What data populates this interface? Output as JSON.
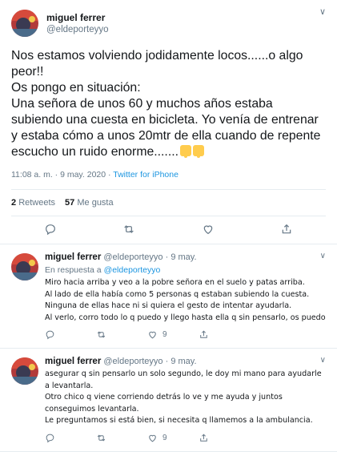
{
  "main_tweet": {
    "name": "miguel ferrer",
    "handle": "@eldeporteyyo",
    "text": "Nos estamos volviendo jodidamente locos......o algo peor!!\nOs pongo en situación:\nUna señora de unos 60 y muchos años estaba subiendo una cuesta en bicicleta. Yo venía de entrenar y estaba cómo a unos 20mtr de ella cuando de repente escucho un ruido enorme.......",
    "timestamp": "11:08 a. m. · 9 may. 2020 · ",
    "source": "Twitter for iPhone",
    "retweets_count": "2",
    "retweets_label": "Retweets",
    "likes_count": "57",
    "likes_label": "Me gusta"
  },
  "replies": [
    {
      "name": "miguel ferrer",
      "handle": "@eldeporteyyo",
      "date": "· 9 may.",
      "in_reply_label": "En respuesta a",
      "in_reply_handle": "@eldeporteyyo",
      "text": "Miro hacia arriba y veo a la pobre señora en el suelo y patas arriba.\nAl lado de ella había como 5 personas q estaban subiendo la cuesta.\nNinguna de ellas hace ni si quiera el gesto de intentar ayudarla.\nAl verlo, corro todo lo q puedo y llego hasta ella q sin pensarlo, os puedo",
      "likes": "9"
    },
    {
      "name": "miguel ferrer",
      "handle": "@eldeporteyyo",
      "date": "· 9 may.",
      "text": "asegurar q sin pensarlo un solo segundo, le doy mi mano para ayudarle a levantarla.\nOtro chico q viene corriendo detrás lo ve y me ayuda y juntos conseguimos levantarla.\nLe preguntamos si está bien, si necesita q llamemos a la ambulancia.",
      "likes": "9"
    }
  ],
  "icons": [
    "reply-icon",
    "retweet-icon",
    "like-icon",
    "share-icon",
    "chevron-down-icon",
    "pointing-down-emoji"
  ],
  "colors": {
    "link": "#1b95e0",
    "muted": "#657786",
    "text": "#14171a",
    "divider": "#e6ecf0"
  }
}
